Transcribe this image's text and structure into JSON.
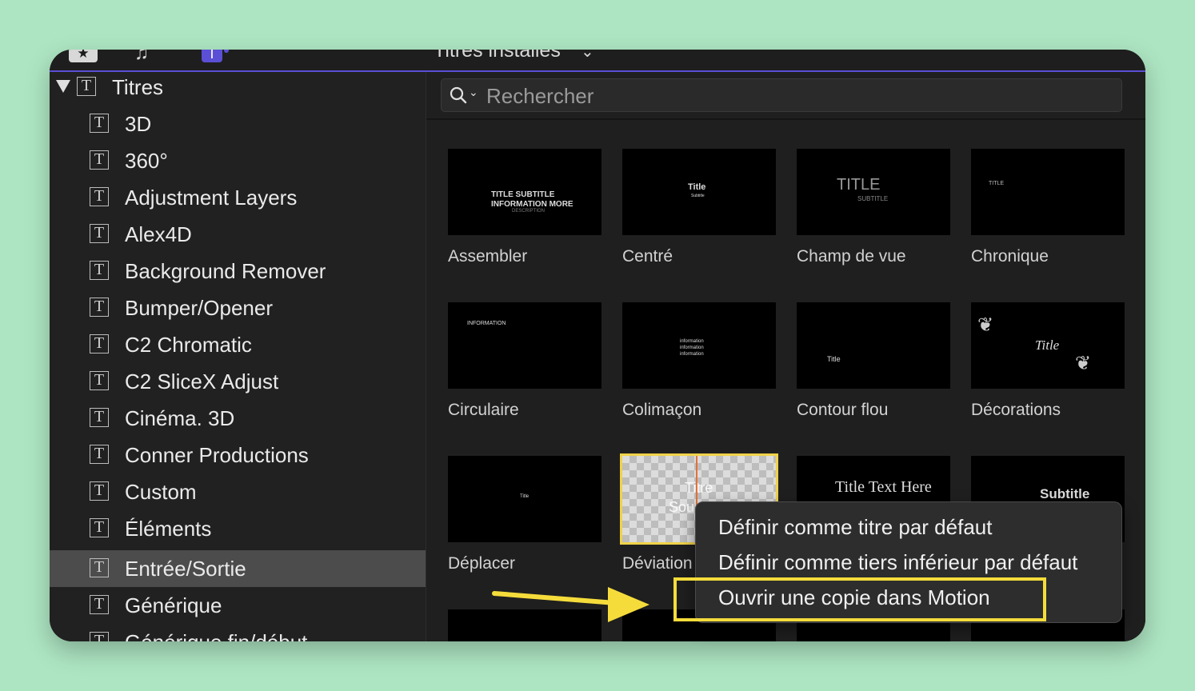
{
  "toolbar": {
    "browser_title": "Titres installés",
    "browser_chevron": "⌄"
  },
  "sidebar": {
    "root": {
      "label": "Titres",
      "expanded": true
    },
    "items": [
      {
        "label": "3D"
      },
      {
        "label": "360°"
      },
      {
        "label": "Adjustment Layers"
      },
      {
        "label": "Alex4D"
      },
      {
        "label": "Background Remover"
      },
      {
        "label": "Bumper/Opener"
      },
      {
        "label": "C2 Chromatic"
      },
      {
        "label": "C2 SliceX Adjust"
      },
      {
        "label": "Cinéma. 3D"
      },
      {
        "label": "Conner Productions"
      },
      {
        "label": "Custom"
      },
      {
        "label": "Éléments"
      },
      {
        "label": "Entrée/Sortie",
        "selected": true
      },
      {
        "label": "Générique"
      },
      {
        "label": "Générique fin/début"
      }
    ],
    "selected_color": "#4c4c4c"
  },
  "search": {
    "placeholder": "Rechercher",
    "value": ""
  },
  "tiles": [
    {
      "name": "Assembler",
      "thumb": {
        "line1": "TITLE SUBTITLE",
        "line2": "INFORMATION MORE",
        "line3": "DESCRIPTION"
      }
    },
    {
      "name": "Centré",
      "thumb": {
        "line1": "Title",
        "line2": "Subtitle"
      }
    },
    {
      "name": "Champ de vue",
      "thumb": {
        "line1": "TITLE",
        "line2": "SUBTITLE"
      }
    },
    {
      "name": "Chronique",
      "thumb": {
        "line1": "TITLE"
      }
    },
    {
      "name": "Circulaire",
      "thumb": {
        "line1": "INFORMATION"
      }
    },
    {
      "name": "Colimaçon",
      "thumb": {
        "line1": "information",
        "line2": "information",
        "line3": "information"
      }
    },
    {
      "name": "Contour flou",
      "thumb": {
        "line1": "Title"
      }
    },
    {
      "name": "Décorations",
      "thumb": {
        "line1": "Title"
      }
    },
    {
      "name": "Déplacer",
      "thumb": {
        "line1": "Title"
      }
    },
    {
      "name": "Déviation",
      "thumb": {
        "line1": "Titre",
        "line2": "Sou"
      },
      "selected": true
    },
    {
      "name": "",
      "thumb": {
        "line1": "Title Text Here"
      }
    },
    {
      "name": "",
      "thumb": {
        "line1": "Subtitle"
      }
    }
  ],
  "context_menu": {
    "items": [
      {
        "label": "Définir comme titre par défaut"
      },
      {
        "label": "Définir comme tiers inférieur par défaut"
      },
      {
        "label": "Ouvrir une copie dans Motion",
        "highlighted": true
      }
    ]
  },
  "annotation": {
    "highlight_color": "#f5dc3b",
    "arrow_color": "#f5dc3b"
  }
}
